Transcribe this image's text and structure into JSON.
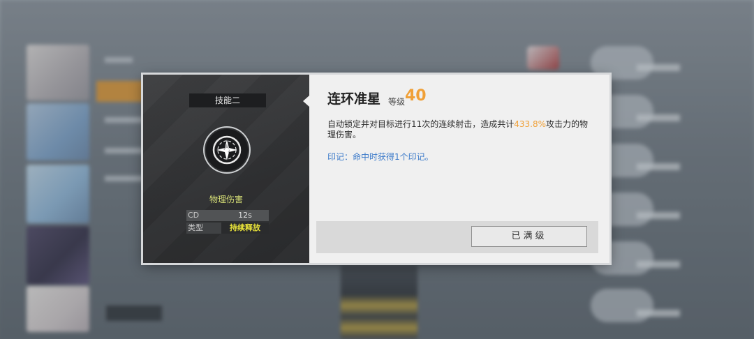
{
  "skill": {
    "slot_label": "技能二",
    "icon": "crosshair-burst-icon",
    "damage_type": "物理伤害",
    "stats": {
      "cd_label": "CD",
      "cd_value": "12s",
      "type_label": "类型",
      "type_value": "持续释放"
    },
    "name": "连环准星",
    "level_label": "等级",
    "level_value": "40",
    "description": {
      "part1": "自动锁定并对目标进行11次的连续射击，造成共计",
      "highlight": "433.8%",
      "part2": "攻击力的物理伤害。"
    },
    "mark_text": "印记：命中时获得1个印记。",
    "max_level_button": "已满级"
  },
  "colors": {
    "accent": "#f0a037",
    "mark_blue": "#3a79c9",
    "type_yellow": "#e8e23a",
    "damage_type": "#d8e077"
  }
}
